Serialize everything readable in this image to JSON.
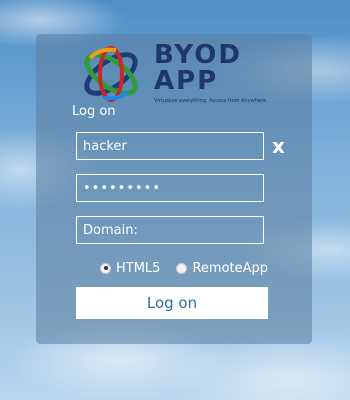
{
  "logo": {
    "word_line1": "BYOD",
    "word_line2": "APP",
    "tagline": "Virtualize everything. Access from Anywhere"
  },
  "form": {
    "title": "Log on",
    "username_value": "hacker",
    "password_value": "hacker123",
    "domain_placeholder": "Domain:",
    "clear_symbol": "x",
    "options": [
      {
        "label": "HTML5",
        "selected": true
      },
      {
        "label": "RemoteApp",
        "selected": false
      }
    ],
    "submit_label": "Log on"
  }
}
